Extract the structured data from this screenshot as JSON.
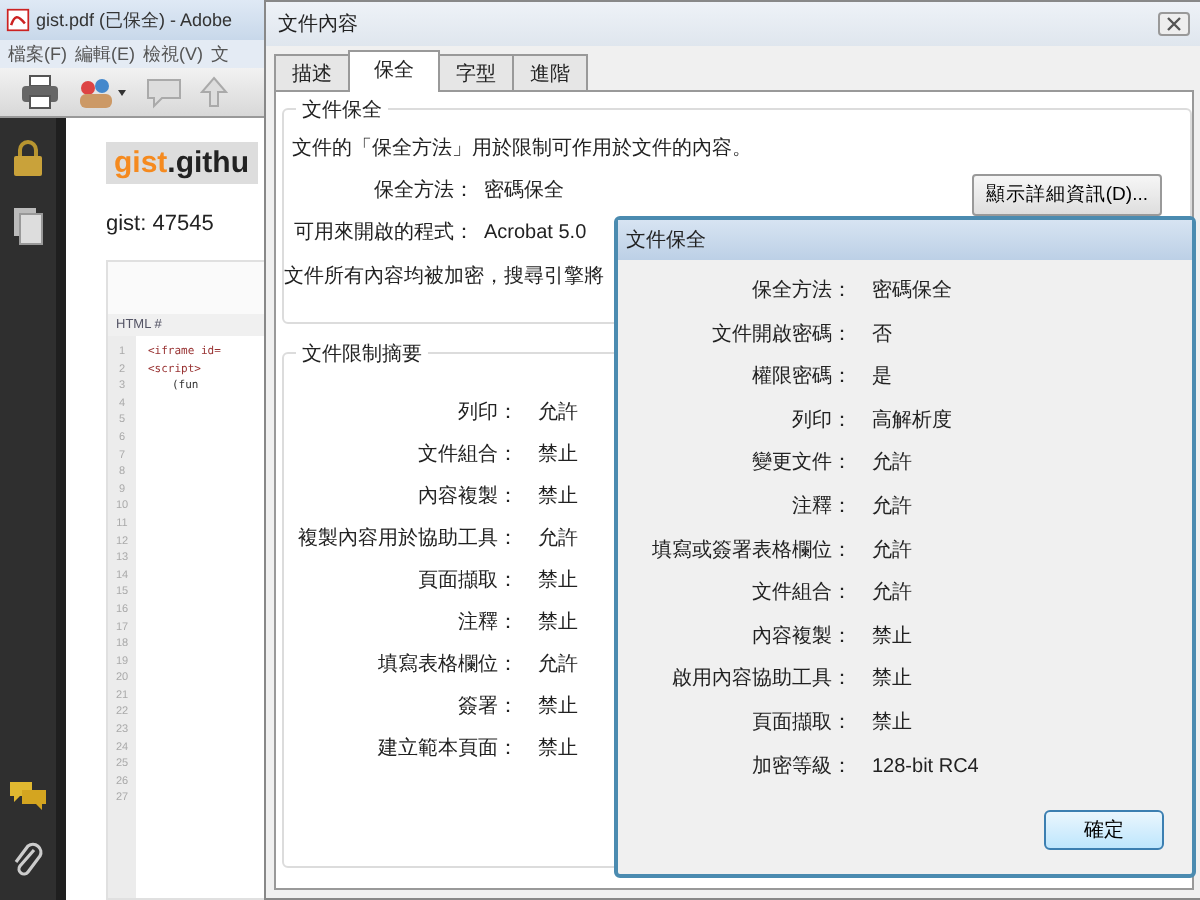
{
  "app_window": {
    "title": "gist.pdf (已保全) - Adobe",
    "menu": [
      "檔案(F)",
      "編輯(E)",
      "檢視(V)",
      "文"
    ]
  },
  "page": {
    "logo_accent": "gist",
    "logo_rest": ".githu",
    "gist_id": "gist: 47545",
    "code_header": "HTML #",
    "code_lines": [
      {
        "text": "<iframe id="
      },
      {
        "text": "<script>",
        "children": [
          {
            "text": "(fun"
          }
        ]
      }
    ],
    "line_numbers": [
      "1",
      "2",
      "3",
      "4",
      "5",
      "6",
      "7",
      "8",
      "9",
      "10",
      "11",
      "12",
      "13",
      "14",
      "15",
      "16",
      "17",
      "18",
      "19",
      "20",
      "21",
      "22",
      "23",
      "24",
      "25",
      "26",
      "27"
    ]
  },
  "properties_dialog": {
    "title": "文件內容",
    "tabs": [
      {
        "label": "描述",
        "selected": false
      },
      {
        "label": "保全",
        "selected": true
      },
      {
        "label": "字型",
        "selected": false
      },
      {
        "label": "進階",
        "selected": false
      }
    ],
    "security_group": {
      "title": "文件保全",
      "description": "文件的「保全方法」用於限制可作用於文件的內容。",
      "rows": [
        {
          "label": "保全方法：",
          "value": "密碼保全"
        },
        {
          "label": "可用來開啟的程式：",
          "value": "Acrobat 5.0"
        }
      ],
      "note": "文件所有內容均被加密，搜尋引擎將",
      "details_button": "顯示詳細資訊(D)..."
    },
    "restrictions_group": {
      "title": "文件限制摘要",
      "rows": [
        {
          "label": "列印：",
          "value": "允許"
        },
        {
          "label": "文件組合：",
          "value": "禁止"
        },
        {
          "label": "內容複製：",
          "value": "禁止"
        },
        {
          "label": "複製內容用於協助工具：",
          "value": "允許"
        },
        {
          "label": "頁面擷取：",
          "value": "禁止"
        },
        {
          "label": "注釋：",
          "value": "禁止"
        },
        {
          "label": "填寫表格欄位：",
          "value": "允許"
        },
        {
          "label": "簽署：",
          "value": "禁止"
        },
        {
          "label": "建立範本頁面：",
          "value": "禁止"
        }
      ]
    }
  },
  "security_dialog": {
    "title": "文件保全",
    "rows": [
      {
        "label": "保全方法：",
        "value": "密碼保全"
      },
      {
        "label": "文件開啟密碼：",
        "value": "否"
      },
      {
        "label": "權限密碼：",
        "value": "是"
      },
      {
        "label": "列印：",
        "value": "高解析度"
      },
      {
        "label": "變更文件：",
        "value": "允許"
      },
      {
        "label": "注釋：",
        "value": "允許"
      },
      {
        "label": "填寫或簽署表格欄位：",
        "value": "允許"
      },
      {
        "label": "文件組合：",
        "value": "允許"
      },
      {
        "label": "內容複製：",
        "value": "禁止"
      },
      {
        "label": "啟用內容協助工具：",
        "value": "禁止"
      },
      {
        "label": "頁面擷取：",
        "value": "禁止"
      },
      {
        "label": "加密等級：",
        "value": "128-bit RC4"
      }
    ],
    "ok_button": "確定"
  }
}
